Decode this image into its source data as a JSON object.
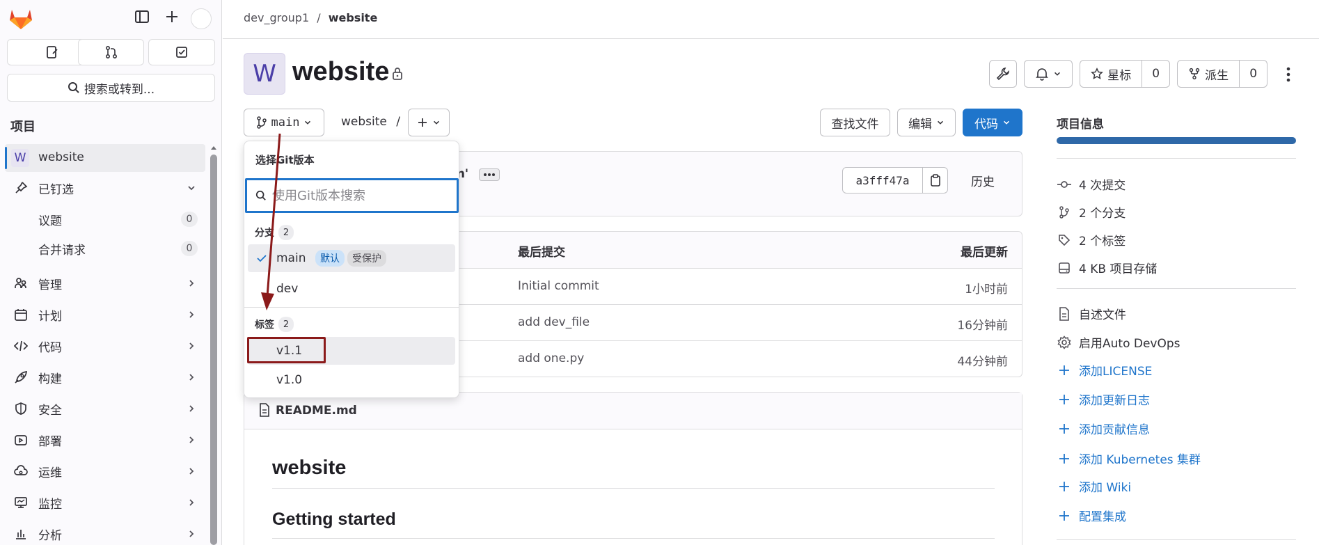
{
  "sidebar": {
    "search_label": "搜索或转到...",
    "section_title": "项目",
    "project": {
      "avatar": "W",
      "name": "website"
    },
    "pinned_label": "已钉选",
    "pinned_items": [
      {
        "label": "议题",
        "count": "0"
      },
      {
        "label": "合并请求",
        "count": "0"
      }
    ],
    "items": [
      {
        "label": "管理",
        "icon": "users-icon"
      },
      {
        "label": "计划",
        "icon": "calendar-icon"
      },
      {
        "label": "代码",
        "icon": "code-icon"
      },
      {
        "label": "构建",
        "icon": "rocket-icon"
      },
      {
        "label": "安全",
        "icon": "shield-icon"
      },
      {
        "label": "部署",
        "icon": "deploy-icon"
      },
      {
        "label": "运维",
        "icon": "cloud-icon"
      },
      {
        "label": "监控",
        "icon": "monitor-icon"
      },
      {
        "label": "分析",
        "icon": "chart-icon"
      }
    ]
  },
  "breadcrumb": {
    "group": "dev_group1",
    "separator": "/",
    "project": "website"
  },
  "header": {
    "avatar": "W",
    "title": "website",
    "star_label": "星标",
    "star_count": "0",
    "fork_label": "派生",
    "fork_count": "0"
  },
  "toolbar": {
    "branch": "main",
    "path_root": "website",
    "path_sep": "/",
    "find_file": "查找文件",
    "edit": "编辑",
    "code": "代码"
  },
  "commit": {
    "message_fragment": "in'",
    "sha": "a3fff47a",
    "history": "历史"
  },
  "files": {
    "headers": {
      "last_commit": "最后提交",
      "last_update": "最后更新"
    },
    "rows": [
      {
        "message": "Initial commit",
        "time": "1小时前"
      },
      {
        "message": "add dev_file",
        "time": "16分钟前"
      },
      {
        "message": "add one.py",
        "time": "44分钟前"
      }
    ]
  },
  "readme": {
    "filename": "README.md",
    "h1": "website",
    "h2": "Getting started"
  },
  "project_info": {
    "title": "项目信息",
    "stats": [
      {
        "icon": "commit-icon",
        "text": "4 次提交"
      },
      {
        "icon": "branch-icon",
        "text": "2 个分支"
      },
      {
        "icon": "tag-icon",
        "text": "2 个标签"
      },
      {
        "icon": "storage-icon",
        "text": "4 KB 项目存储"
      }
    ],
    "actions": [
      {
        "icon": "file-icon",
        "text": "自述文件",
        "link": false
      },
      {
        "icon": "settings-icon",
        "text": "启用Auto DevOps",
        "link": false
      },
      {
        "icon": "plus-icon",
        "text": "添加LICENSE",
        "link": true
      },
      {
        "icon": "plus-icon",
        "text": "添加更新日志",
        "link": true
      },
      {
        "icon": "plus-icon",
        "text": "添加贡献信息",
        "link": true
      },
      {
        "icon": "plus-icon",
        "text": "添加 Kubernetes 集群",
        "link": true
      },
      {
        "icon": "plus-icon",
        "text": "添加 Wiki",
        "link": true
      },
      {
        "icon": "plus-icon",
        "text": "配置集成",
        "link": true
      }
    ]
  },
  "ref_dropdown": {
    "title": "选择Git版本",
    "search_placeholder": "使用Git版本搜索",
    "branches_label": "分支",
    "branches_count": "2",
    "branches": [
      {
        "name": "main",
        "badges": [
          "默认",
          "受保护"
        ],
        "selected": true
      },
      {
        "name": "dev",
        "badges": [],
        "selected": false
      }
    ],
    "tags_label": "标签",
    "tags_count": "2",
    "tags": [
      {
        "name": "v1.1",
        "highlighted": true
      },
      {
        "name": "v1.0",
        "highlighted": false
      }
    ]
  },
  "colors": {
    "primary": "#1f75cb",
    "annotation": "#8b1a1a",
    "info_bar": "#2e68a8"
  }
}
